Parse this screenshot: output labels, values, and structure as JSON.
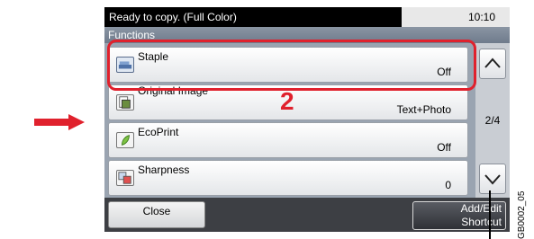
{
  "status_bar": {
    "message": "Ready to copy. (Full Color)",
    "time": "10:10"
  },
  "header": {
    "title": "Functions"
  },
  "functions": [
    {
      "label": "Staple",
      "value": "Off",
      "icon": "staple-icon"
    },
    {
      "label": "Original Image",
      "value": "Text+Photo",
      "icon": "original-image-icon"
    },
    {
      "label": "EcoPrint",
      "value": "Off",
      "icon": "ecoprint-icon"
    },
    {
      "label": "Sharpness",
      "value": "0",
      "icon": "sharpness-icon"
    }
  ],
  "pagination": {
    "page": "2/4"
  },
  "footer": {
    "close_label": "Close",
    "add_edit_line1": "Add/Edit",
    "add_edit_line2": "Shortcut"
  },
  "annotation": {
    "step_number": "2",
    "figure_code": "GB0002_05"
  },
  "colors": {
    "highlight": "#e0212d",
    "arrow": "#e0212d"
  }
}
